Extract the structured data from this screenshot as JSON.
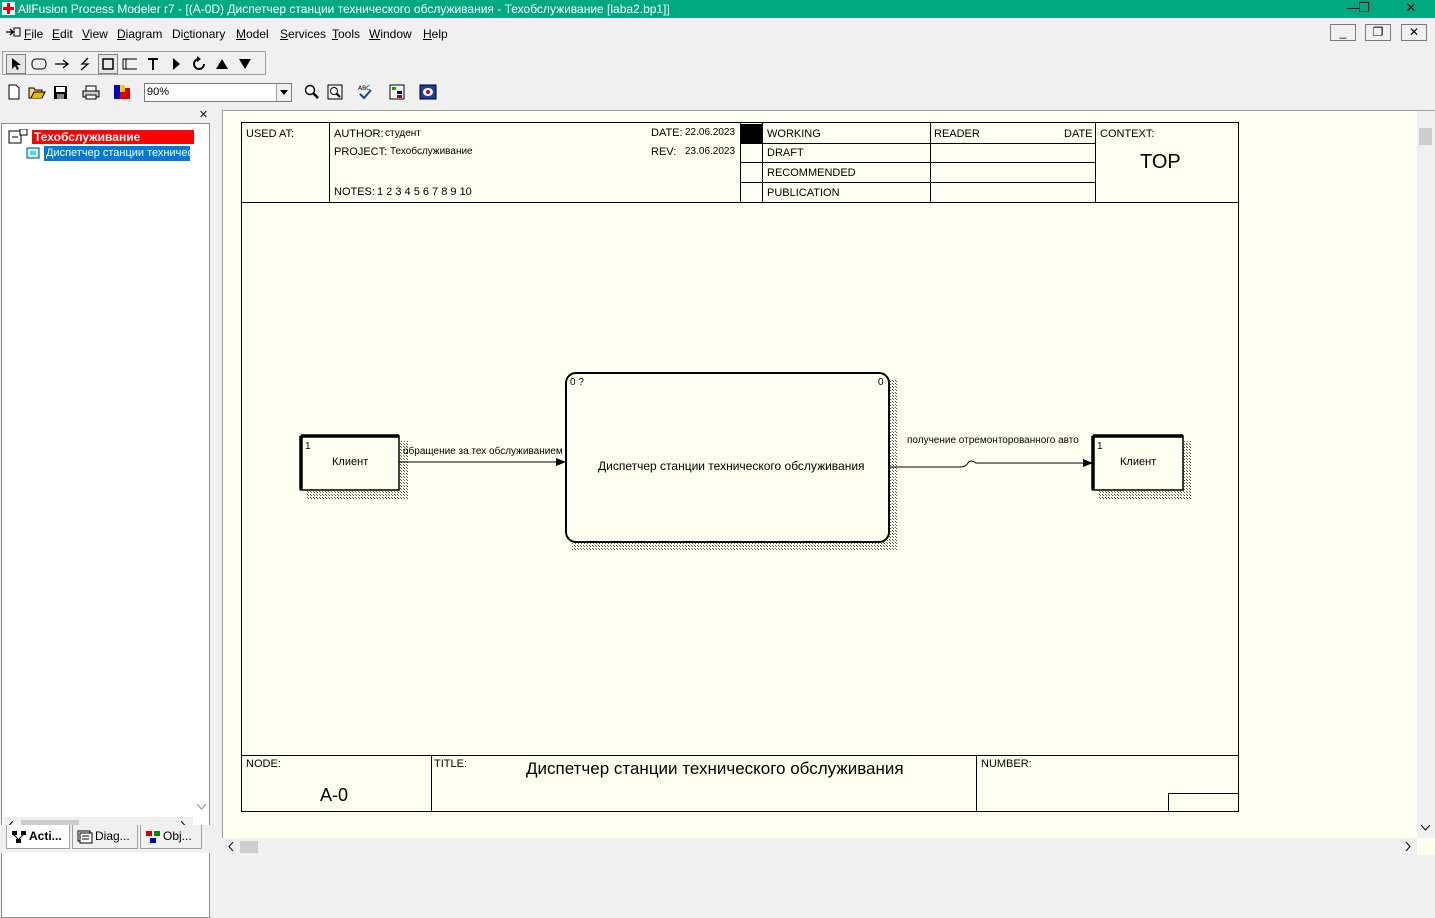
{
  "window": {
    "title": "AllFusion Process Modeler r7 - [(A-0D) Диспетчер станции технического обслуживания - Техобслуживание  [laba2.bp1]]",
    "minimize": "—",
    "restore": "❐",
    "close": "✕"
  },
  "menu": {
    "items": [
      {
        "u": "F",
        "rest": "ile"
      },
      {
        "u": "E",
        "rest": "dit"
      },
      {
        "u": "V",
        "rest": "iew"
      },
      {
        "u": "D",
        "rest": "iagram"
      },
      {
        "pre": "Di",
        "u": "c",
        "rest": "tionary"
      },
      {
        "u": "M",
        "rest": "odel"
      },
      {
        "u": "S",
        "rest": "ervices"
      },
      {
        "u": "T",
        "rest": "ools"
      },
      {
        "u": "W",
        "rest": "indow"
      },
      {
        "u": "H",
        "rest": "elp"
      }
    ],
    "mdi_minimize": "_",
    "mdi_restore": "❐",
    "mdi_close": "✕"
  },
  "toolbar": {
    "zoom_value": "90%"
  },
  "tree": {
    "root_label": "Техобслуживание",
    "child_label": "Диспетчер станции технического обслуживания",
    "close": "✕"
  },
  "tabs": [
    {
      "label": "Acti..."
    },
    {
      "label": "Diag..."
    },
    {
      "label": "Obj..."
    }
  ],
  "header": {
    "used_at": "USED AT:",
    "author_label": "AUTHOR:",
    "author_value": "студент",
    "project_label": "PROJECT:",
    "project_value": "Техобслуживание",
    "notes_label": "NOTES:",
    "notes_value": "1  2  3  4  5  6  7  8  9  10",
    "date_label": "DATE:",
    "date_value": "22.06.2023",
    "rev_label": "REV:",
    "rev_value": "23.06.2023",
    "status": [
      "WORKING",
      "DRAFT",
      "RECOMMENDED",
      "PUBLICATION"
    ],
    "reader_label": "READER",
    "reader_date_label": "DATE",
    "context_label": "CONTEXT:",
    "context_value": "TOP"
  },
  "diagram": {
    "main_box": {
      "label": "Диспетчер станции технического обслуживания",
      "corner_left": "0 ?",
      "corner_right": "0"
    },
    "left_ext": {
      "label": "Клиент",
      "num": "1"
    },
    "right_ext": {
      "label": "Клиент",
      "num": "1"
    },
    "arrow_in": "обращение за тех обслуживанием",
    "arrow_out": "получение отремонторованного авто"
  },
  "footer": {
    "node_label": "NODE:",
    "node_value": "A-0",
    "title_label": "TITLE:",
    "title_value": "Диспетчер станции технического обслуживания",
    "number_label": "NUMBER:"
  }
}
